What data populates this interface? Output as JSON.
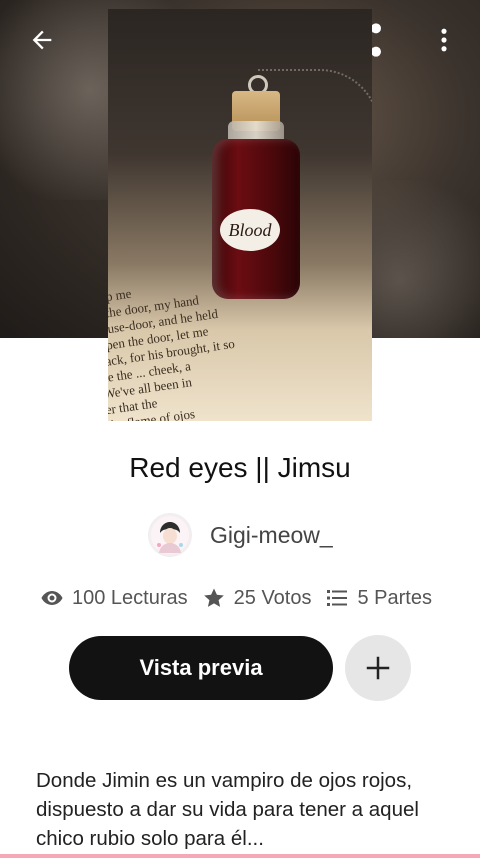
{
  "header": {
    "back_icon": "arrow-left-icon",
    "share_icon": "share-icon",
    "more_icon": "more-vertical-icon"
  },
  "cover": {
    "label_text": "Blood",
    "page_text": [
      "help me",
      "ut the door, my hand",
      "house-door, and he held",
      "Open the door, let me",
      "back, for his brought, it so",
      "de the ... cheek, a",
      "We've all been in",
      "er that the",
      "the flame of ojos"
    ]
  },
  "story": {
    "title": "Red eyes || Jimsu",
    "author": "Gigi-meow_",
    "stats": {
      "reads": "100 Lecturas",
      "votes": "25 Votos",
      "parts": "5 Partes"
    },
    "preview_label": "Vista previa",
    "add_label": "+",
    "description": "Donde Jimin es un vampiro de ojos rojos, dispuesto a dar su vida para tener a aquel chico rubio solo para él..."
  },
  "colors": {
    "primary_button": "#121212",
    "secondary_button": "#e6e6e6",
    "accent_line": "#f5a9b8"
  }
}
